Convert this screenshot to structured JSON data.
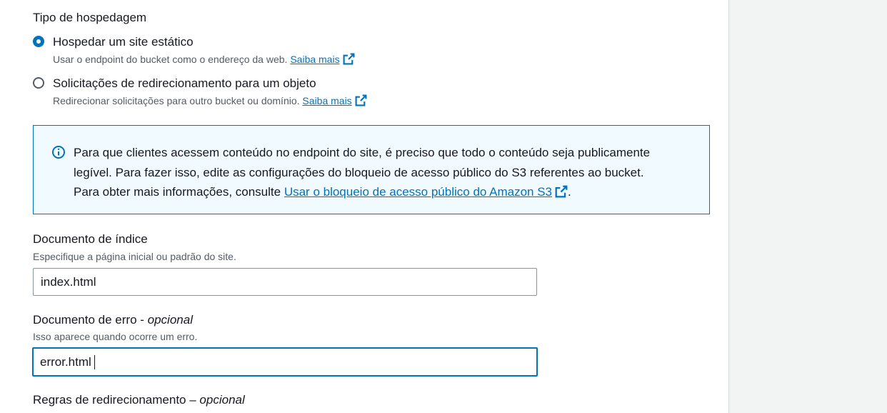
{
  "hosting_type": {
    "label": "Tipo de hospedagem",
    "options": [
      {
        "label": "Hospedar um site estático",
        "description": "Usar o endpoint do bucket como o endereço da web.",
        "link": "Saiba mais",
        "selected": true
      },
      {
        "label": "Solicitações de redirecionamento para um objeto",
        "description": "Redirecionar solicitações para outro bucket ou domínio.",
        "link": "Saiba mais",
        "selected": false
      }
    ]
  },
  "info_alert": {
    "line1": "Para que clientes acessem conteúdo no endpoint do site, é preciso que todo o conteúdo seja publicamente",
    "line2": "legível. Para fazer isso, edite as configurações do bloqueio de acesso público do S3 referentes ao bucket.",
    "line3_prefix": "Para obter mais informações, consulte",
    "link": "Usar o bloqueio de acesso público do Amazon S3",
    "line3_suffix": "."
  },
  "index_document": {
    "label": "Documento de índice",
    "description": "Especifique a página inicial ou padrão do site.",
    "value": "index.html"
  },
  "error_document": {
    "label": "Documento de erro -",
    "optional": "opcional",
    "description": "Isso aparece quando ocorre um erro.",
    "value": "error.html"
  },
  "redirect_rules": {
    "label": "Regras de redirecionamento –",
    "optional": "opcional"
  },
  "colors": {
    "accent": "#0073bb",
    "alert_bg": "#f1faff",
    "text": "#16191f",
    "secondary_text": "#545b64"
  },
  "icons": [
    "radio-selected-icon",
    "radio-unselected-icon",
    "external-link-icon",
    "info-icon"
  ]
}
